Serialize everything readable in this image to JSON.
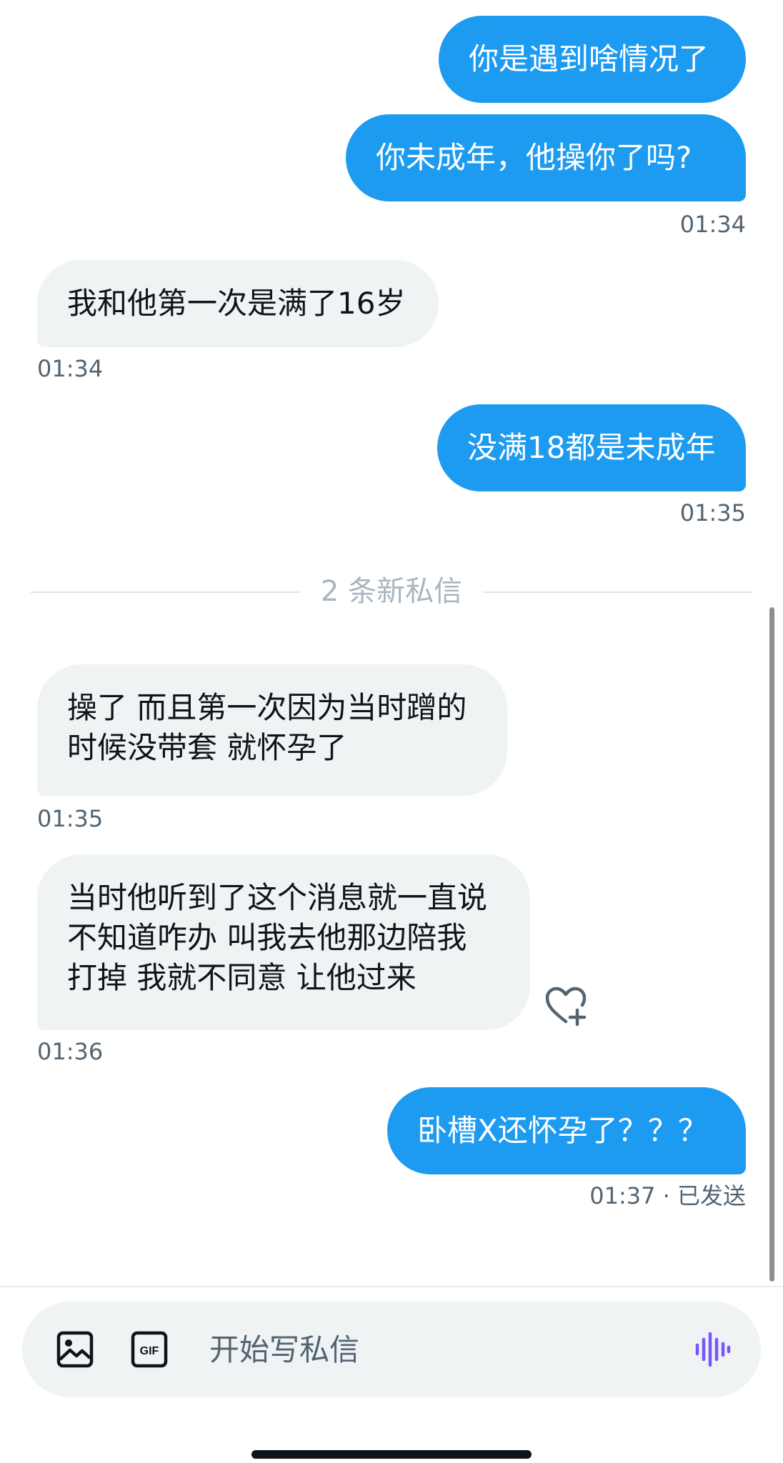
{
  "messages": [
    {
      "direction": "out",
      "text": "你是遇到啥情况了"
    },
    {
      "direction": "out",
      "text": "你未成年，他操你了吗?"
    },
    {
      "direction": "in",
      "text": "我和他第一次是满了16岁"
    },
    {
      "direction": "out",
      "text": "没满18都是未成年"
    },
    {
      "direction": "in",
      "text": "操了 而且第一次因为当时蹭的\n时候没带套 就怀孕了"
    },
    {
      "direction": "in",
      "text": "当时他听到了这个消息就一直说\n不知道咋办 叫我去他那边陪我\n打掉 我就不同意 让他过来"
    },
    {
      "direction": "out",
      "text": "卧槽X还怀孕了？？？"
    }
  ],
  "timestamps": [
    "01:34",
    "01:34",
    "01:35",
    "01:35",
    "01:36",
    "01:37 · 已发送"
  ],
  "divider": {
    "text": "2 条新私信"
  },
  "composer": {
    "placeholder": "开始写私信",
    "gif_label": "GIF"
  },
  "colors": {
    "accent": "#1d9bf0",
    "incoming_bubble": "#eff3f4",
    "voice_icon": "#7856ff"
  },
  "icons": [
    "image-icon",
    "gif-icon",
    "voice-message-icon",
    "heart-plus-icon"
  ]
}
